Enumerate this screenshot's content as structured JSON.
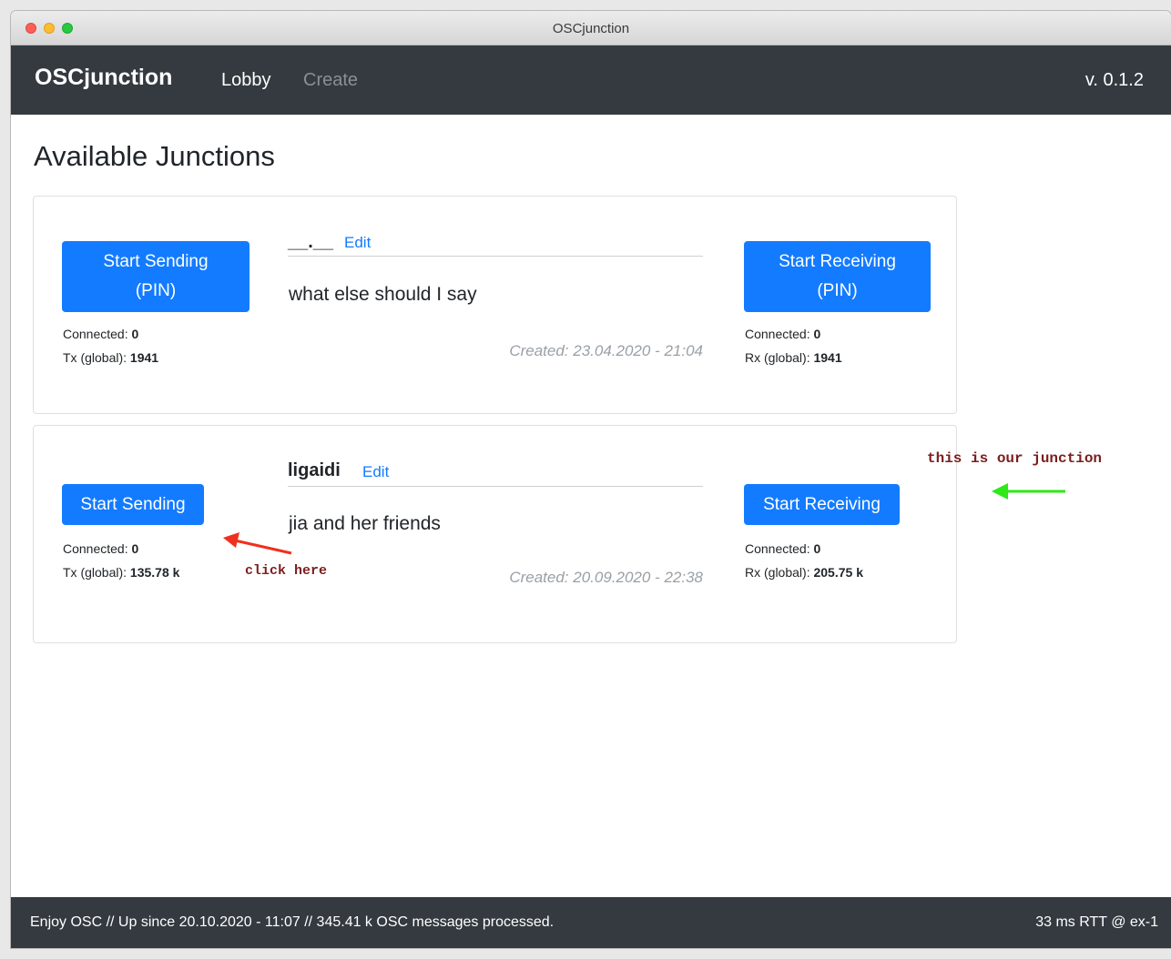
{
  "window": {
    "title": "OSCjunction"
  },
  "navbar": {
    "brand": "OSCjunction",
    "lobby": "Lobby",
    "create": "Create",
    "version": "v. 0.1.2"
  },
  "main": {
    "title": "Available Junctions"
  },
  "junctions": [
    {
      "name": "__.__",
      "edit_label": "Edit",
      "description": "what else should I say",
      "created": "Created: 23.04.2020 - 21:04",
      "send_button_line1": "Start Sending",
      "send_button_line2": "(PIN)",
      "receive_button_line1": "Start Receiving",
      "receive_button_line2": "(PIN)",
      "send_connected_label": "Connected:",
      "send_connected": "0",
      "tx_label": "Tx (global):",
      "tx_value": "1941",
      "receive_connected_label": "Connected:",
      "receive_connected": "0",
      "rx_label": "Rx (global):",
      "rx_value": "1941"
    },
    {
      "name": "ligaidi",
      "edit_label": "Edit",
      "description": "jia and her friends",
      "created": "Created: 20.09.2020 - 22:38",
      "send_button": "Start Sending",
      "receive_button": "Start Receiving",
      "send_connected_label": "Connected:",
      "send_connected": "0",
      "tx_label": "Tx (global):",
      "tx_value": "135.78 k",
      "receive_connected_label": "Connected:",
      "receive_connected": "0",
      "rx_label": "Rx (global):",
      "rx_value": "205.75 k"
    }
  ],
  "annotations": {
    "click_here": "click here",
    "our_junction": "this is our junction",
    "red_arrow_color": "#f0301e",
    "green_arrow_color": "#2ee817"
  },
  "footer": {
    "left": "Enjoy OSC // Up since 20.10.2020 - 11:07 // 345.41 k OSC messages processed.",
    "right": "33 ms RTT @ ex-1"
  },
  "colors": {
    "primary": "#137bff",
    "navbar": "#343a40"
  }
}
